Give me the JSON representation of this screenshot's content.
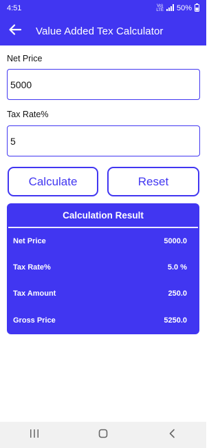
{
  "status": {
    "time": "4:51",
    "network_top": "Vo)",
    "network_bottom": "LTE",
    "battery": "50%"
  },
  "appbar": {
    "title": "Value Added Tex Calculator"
  },
  "form": {
    "net_price_label": "Net Price",
    "net_price_value": "5000",
    "tax_rate_label": "Tax Rate%",
    "tax_rate_value": "5"
  },
  "buttons": {
    "calculate": "Calculate",
    "reset": "Reset"
  },
  "result": {
    "title": "Calculation Result",
    "rows": [
      {
        "label": "Net Price",
        "value": "5000.0"
      },
      {
        "label": "Tax Rate%",
        "value": "5.0 %"
      },
      {
        "label": "Tax Amount",
        "value": "250.0"
      },
      {
        "label": "Gross Price",
        "value": "5250.0"
      }
    ]
  },
  "colors": {
    "primary": "#4136f1",
    "background": "#ffffff",
    "navbar": "#f1f1f1"
  },
  "icons": {
    "back": "arrow-left-icon",
    "signal": "signal-icon",
    "battery": "battery-icon",
    "nav_recents": "recents-icon",
    "nav_home": "home-icon",
    "nav_back": "back-icon"
  }
}
